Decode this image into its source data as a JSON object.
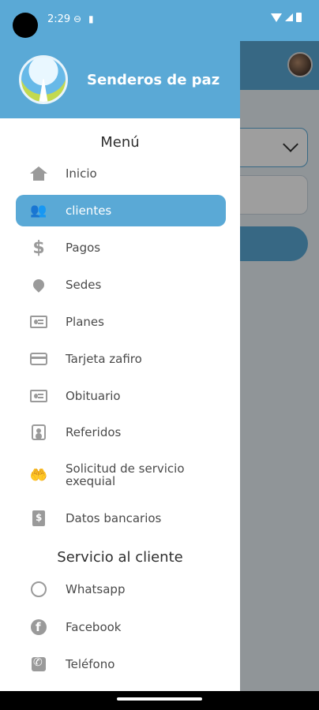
{
  "status_bar": {
    "time": "2:29"
  },
  "drawer": {
    "brand": "Senderos de paz",
    "menu_title": "Menú",
    "menu_items": [
      {
        "label": "Inicio",
        "icon": "home-icon"
      },
      {
        "label": "clientes",
        "icon": "people-icon",
        "active": true
      },
      {
        "label": "Pagos",
        "icon": "dollar-icon"
      },
      {
        "label": "Sedes",
        "icon": "location-pin-icon"
      },
      {
        "label": "Planes",
        "icon": "id-card-icon"
      },
      {
        "label": "Tarjeta zafiro",
        "icon": "credit-card-icon"
      },
      {
        "label": "Obituario",
        "icon": "id-card-icon"
      },
      {
        "label": "Referidos",
        "icon": "contact-icon"
      },
      {
        "label": "Solicitud de servicio exequial",
        "icon": "hand-heart-icon"
      },
      {
        "label": "Datos bancarios",
        "icon": "bank-document-icon"
      }
    ],
    "service_title": "Servicio al cliente",
    "service_items": [
      {
        "label": "Whatsapp",
        "icon": "whatsapp-icon"
      },
      {
        "label": "Facebook",
        "icon": "facebook-icon"
      },
      {
        "label": "Teléfono",
        "icon": "phone-icon"
      }
    ]
  },
  "colors": {
    "primary": "#5aa9d6",
    "scrim": "rgba(0,0,0,0.38)"
  }
}
